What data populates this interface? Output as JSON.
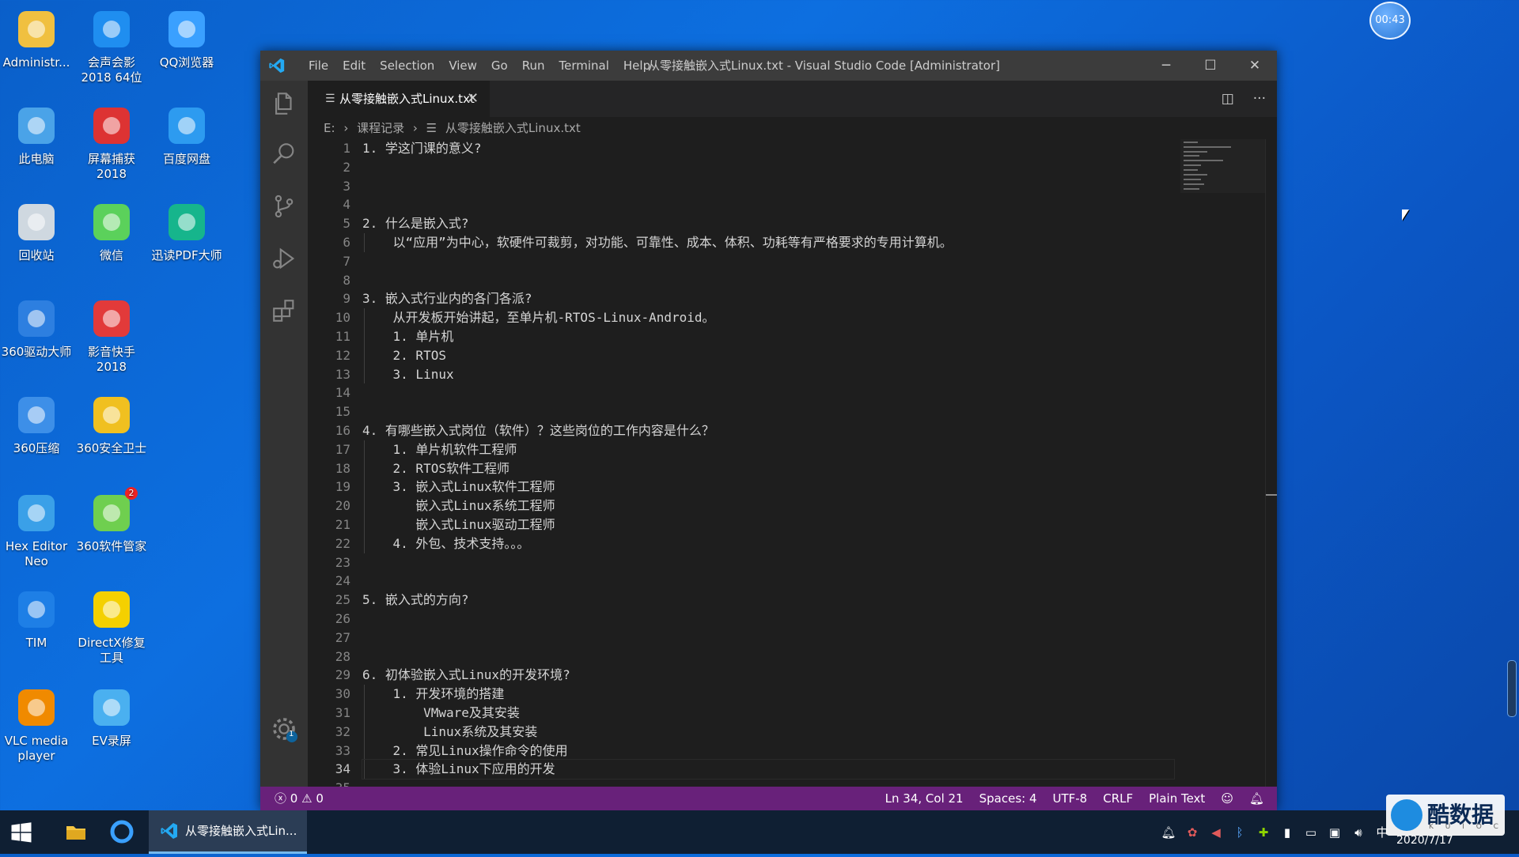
{
  "desktop": {
    "icons": [
      {
        "label": "Administr...",
        "icon": "user-folder-icon"
      },
      {
        "label": "会声会影\n2018 64位",
        "icon": "video-editor-icon"
      },
      {
        "label": "QQ浏览器",
        "icon": "qq-browser-icon"
      },
      {
        "label": "此电脑",
        "icon": "computer-icon"
      },
      {
        "label": "屏幕捕获\n2018",
        "icon": "screen-capture-icon"
      },
      {
        "label": "百度网盘",
        "icon": "baidu-netdisk-icon"
      },
      {
        "label": "回收站",
        "icon": "recycle-bin-icon"
      },
      {
        "label": "微信",
        "icon": "wechat-icon"
      },
      {
        "label": "迅读PDF大师",
        "icon": "pdf-icon"
      },
      {
        "label": "360驱动大师",
        "icon": "driver-master-icon"
      },
      {
        "label": "影音快手\n2018",
        "icon": "media-icon"
      },
      {
        "label": "360压缩",
        "icon": "compress-icon"
      },
      {
        "label": "360安全卫士",
        "icon": "security-icon"
      },
      {
        "label": "Hex Editor\nNeo",
        "icon": "hex-editor-icon"
      },
      {
        "label": "360软件管家",
        "icon": "software-manager-icon"
      },
      {
        "label": "TIM",
        "icon": "tim-icon"
      },
      {
        "label": "DirectX修复\n工具",
        "icon": "directx-repair-icon"
      },
      {
        "label": "VLC media\nplayer",
        "icon": "vlc-icon"
      },
      {
        "label": "EV录屏",
        "icon": "ev-recorder-icon"
      }
    ],
    "clock_bubble": "00:43",
    "badge_software_manager": "2"
  },
  "window": {
    "title": "从零接触嵌入式Linux.txt - Visual Studio Code [Administrator]",
    "menu": [
      "File",
      "Edit",
      "Selection",
      "View",
      "Go",
      "Run",
      "Terminal",
      "Help"
    ],
    "tab": {
      "name": "从零接触嵌入式Linux.txt",
      "close": "✕"
    },
    "breadcrumb": [
      "E:",
      "课程记录",
      "从零接触嵌入式Linux.txt"
    ],
    "current_line": 34,
    "lines": [
      "1. 学这门课的意义?",
      "",
      "",
      "",
      "2. 什么是嵌入式?",
      "    以“应用”为中心，软硬件可裁剪，对功能、可靠性、成本、体积、功耗等有严格要求的专用计算机。",
      "",
      "",
      "3. 嵌入式行业内的各门各派?",
      "    从开发板开始讲起，至单片机-RTOS-Linux-Android。",
      "    1. 单片机",
      "    2. RTOS",
      "    3. Linux",
      "",
      "",
      "4. 有哪些嵌入式岗位（软件）？这些岗位的工作内容是什么？",
      "    1. 单片机软件工程师",
      "    2. RTOS软件工程师",
      "    3. 嵌入式Linux软件工程师",
      "       嵌入式Linux系统工程师",
      "       嵌入式Linux驱动工程师",
      "    4. 外包、技术支持。。。",
      "",
      "",
      "5. 嵌入式的方向?",
      "",
      "",
      "",
      "6. 初体验嵌入式Linux的开发环境?",
      "    1. 开发环境的搭建",
      "        VMware及其安装",
      "        Linux系统及其安装",
      "    2. 常见Linux操作命令的使用",
      "    3. 体验Linux下应用的开发",
      ""
    ],
    "status": {
      "errors": "0",
      "warnings": "0",
      "position": "Ln 34, Col 21",
      "spaces": "Spaces: 4",
      "encoding": "UTF-8",
      "eol": "CRLF",
      "language": "Plain Text"
    },
    "settings_badge": "1"
  },
  "taskbar": {
    "active_app": "从零接触嵌入式Lin...",
    "ime": "中",
    "date": "2020/7/17"
  },
  "watermark": {
    "text": "酷数据",
    "sub": "K U I O C"
  }
}
